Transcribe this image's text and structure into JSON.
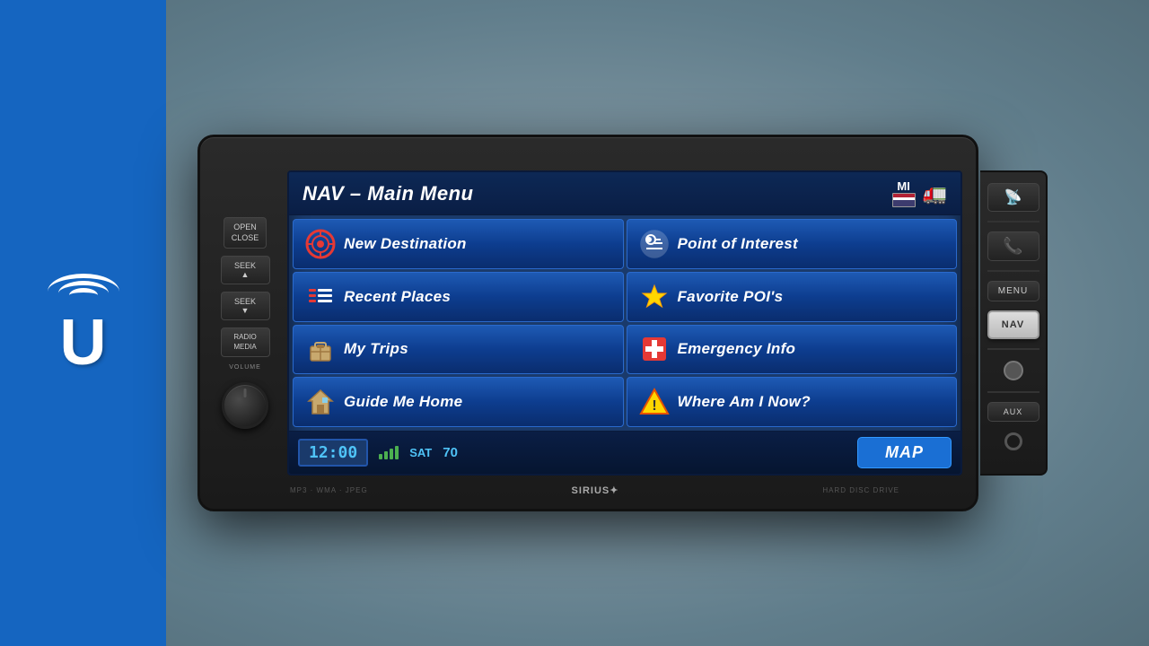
{
  "sidebar": {
    "logo_letter": "U"
  },
  "device": {
    "controls": {
      "open_close": "OPEN\nCLOSE",
      "seek_up": "SEEK\n▲",
      "seek_down": "SEEK\n▼",
      "radio_media": "RADIO\nMEDIA",
      "volume": "VOLUME"
    },
    "screen": {
      "title": "NAV – Main Menu",
      "state_code": "MI",
      "menu_items": [
        {
          "label": "New Destination",
          "icon": "target-icon",
          "position": "top-left"
        },
        {
          "label": "Point of Interest",
          "icon": "poi-icon",
          "position": "top-right"
        },
        {
          "label": "Recent Places",
          "icon": "list-icon",
          "position": "mid-left"
        },
        {
          "label": "Favorite POI's",
          "icon": "star-icon",
          "position": "mid-right"
        },
        {
          "label": "My Trips",
          "icon": "bag-icon",
          "position": "lower-left"
        },
        {
          "label": "Emergency Info",
          "icon": "cross-icon",
          "position": "lower-right"
        },
        {
          "label": "Guide Me Home",
          "icon": "home-icon",
          "position": "bottom-left"
        },
        {
          "label": "Where Am I Now?",
          "icon": "warning-icon",
          "position": "bottom-right"
        }
      ],
      "status_bar": {
        "time": "12:00",
        "satellite_label": "SAT",
        "channel": "70",
        "map_button": "MAP"
      }
    },
    "bottom_labels": {
      "formats": "MP3 · WMA · JPEG",
      "brand": "SIRIUS✦",
      "storage": "HARD DISC DRIVE"
    },
    "right_panel": {
      "menu_label": "MENU",
      "nav_label": "NAV",
      "aux_label": "AUX"
    }
  }
}
